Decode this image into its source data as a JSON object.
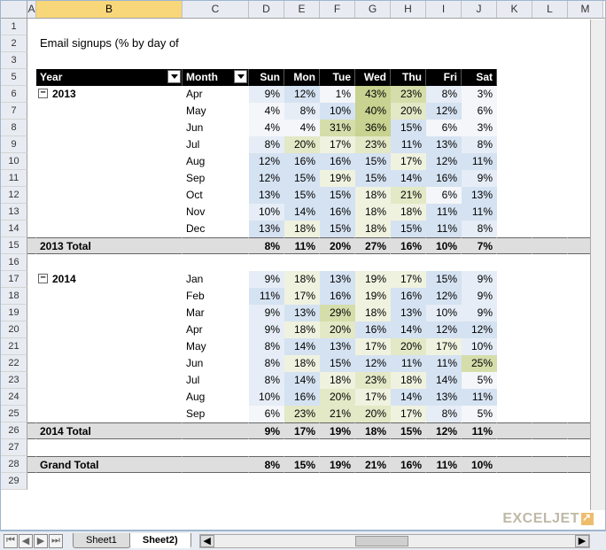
{
  "columns": [
    "A",
    "B",
    "C",
    "D",
    "E",
    "F",
    "G",
    "H",
    "I",
    "J",
    "K",
    "L",
    "M"
  ],
  "selected_column": "B",
  "row_numbers": [
    1,
    2,
    3,
    "",
    5,
    6,
    7,
    8,
    9,
    10,
    11,
    12,
    13,
    14,
    15,
    16,
    17,
    18,
    19,
    20,
    21,
    22,
    23,
    24,
    25,
    26,
    27,
    28,
    29
  ],
  "title": "Email signups (% by day of week)",
  "pivot_headers": {
    "year": "Year",
    "month": "Month",
    "days": [
      "Sun",
      "Mon",
      "Tue",
      "Wed",
      "Thu",
      "Fri",
      "Sat"
    ]
  },
  "sections": [
    {
      "year": "2013",
      "rows": [
        {
          "month": "Apr",
          "v": [
            "9%",
            "12%",
            "1%",
            "43%",
            "23%",
            "8%",
            "3%"
          ],
          "cls": [
            "h1",
            "h2",
            "h0",
            "g3",
            "g2",
            "h1",
            "h0"
          ]
        },
        {
          "month": "May",
          "v": [
            "4%",
            "8%",
            "10%",
            "40%",
            "20%",
            "12%",
            "6%"
          ],
          "cls": [
            "h0",
            "h1",
            "h2",
            "g3",
            "g1",
            "h2",
            "h0"
          ]
        },
        {
          "month": "Jun",
          "v": [
            "4%",
            "4%",
            "31%",
            "36%",
            "15%",
            "6%",
            "3%"
          ],
          "cls": [
            "h0",
            "h0",
            "g2",
            "g3",
            "h2",
            "h0",
            "h0"
          ]
        },
        {
          "month": "Jul",
          "v": [
            "8%",
            "20%",
            "17%",
            "23%",
            "11%",
            "13%",
            "8%"
          ],
          "cls": [
            "h1",
            "g1",
            "g0",
            "g1",
            "h2",
            "h2",
            "h1"
          ]
        },
        {
          "month": "Aug",
          "v": [
            "12%",
            "16%",
            "16%",
            "15%",
            "17%",
            "12%",
            "11%"
          ],
          "cls": [
            "h2",
            "h2",
            "h2",
            "h2",
            "g0",
            "h2",
            "h2"
          ]
        },
        {
          "month": "Sep",
          "v": [
            "12%",
            "15%",
            "19%",
            "15%",
            "14%",
            "16%",
            "9%"
          ],
          "cls": [
            "h2",
            "h2",
            "g0",
            "h2",
            "h2",
            "h2",
            "h1"
          ]
        },
        {
          "month": "Oct",
          "v": [
            "13%",
            "15%",
            "15%",
            "18%",
            "21%",
            "6%",
            "13%"
          ],
          "cls": [
            "h2",
            "h2",
            "h2",
            "g0",
            "g1",
            "h0",
            "h2"
          ]
        },
        {
          "month": "Nov",
          "v": [
            "10%",
            "14%",
            "16%",
            "18%",
            "18%",
            "11%",
            "11%"
          ],
          "cls": [
            "h1",
            "h2",
            "h2",
            "g0",
            "g0",
            "h2",
            "h2"
          ]
        },
        {
          "month": "Dec",
          "v": [
            "13%",
            "18%",
            "15%",
            "18%",
            "15%",
            "11%",
            "8%"
          ],
          "cls": [
            "h2",
            "g0",
            "h2",
            "g0",
            "h2",
            "h2",
            "h1"
          ]
        }
      ],
      "total_label": "2013 Total",
      "total": [
        "8%",
        "11%",
        "20%",
        "27%",
        "16%",
        "10%",
        "7%"
      ]
    },
    {
      "year": "2014",
      "rows": [
        {
          "month": "Jan",
          "v": [
            "9%",
            "18%",
            "13%",
            "19%",
            "17%",
            "15%",
            "9%"
          ],
          "cls": [
            "h1",
            "g0",
            "h2",
            "g0",
            "g0",
            "h2",
            "h1"
          ]
        },
        {
          "month": "Feb",
          "v": [
            "11%",
            "17%",
            "16%",
            "19%",
            "16%",
            "12%",
            "9%"
          ],
          "cls": [
            "h2",
            "g0",
            "h2",
            "g0",
            "h2",
            "h2",
            "h1"
          ]
        },
        {
          "month": "Mar",
          "v": [
            "9%",
            "13%",
            "29%",
            "18%",
            "13%",
            "10%",
            "9%"
          ],
          "cls": [
            "h1",
            "h2",
            "g2",
            "g0",
            "h2",
            "h1",
            "h1"
          ]
        },
        {
          "month": "Apr",
          "v": [
            "9%",
            "18%",
            "20%",
            "16%",
            "14%",
            "12%",
            "12%"
          ],
          "cls": [
            "h1",
            "g0",
            "g1",
            "h2",
            "h2",
            "h2",
            "h2"
          ]
        },
        {
          "month": "May",
          "v": [
            "8%",
            "14%",
            "13%",
            "17%",
            "20%",
            "17%",
            "10%"
          ],
          "cls": [
            "h1",
            "h2",
            "h2",
            "g0",
            "g1",
            "g0",
            "h1"
          ]
        },
        {
          "month": "Jun",
          "v": [
            "8%",
            "18%",
            "15%",
            "12%",
            "11%",
            "11%",
            "25%"
          ],
          "cls": [
            "h1",
            "g0",
            "h2",
            "h2",
            "h2",
            "h2",
            "g2"
          ]
        },
        {
          "month": "Jul",
          "v": [
            "8%",
            "14%",
            "18%",
            "23%",
            "18%",
            "14%",
            "5%"
          ],
          "cls": [
            "h1",
            "h2",
            "g0",
            "g1",
            "g0",
            "h2",
            "h0"
          ]
        },
        {
          "month": "Aug",
          "v": [
            "10%",
            "16%",
            "20%",
            "17%",
            "14%",
            "13%",
            "11%"
          ],
          "cls": [
            "h1",
            "h2",
            "g1",
            "g0",
            "h2",
            "h2",
            "h2"
          ]
        },
        {
          "month": "Sep",
          "v": [
            "6%",
            "23%",
            "21%",
            "20%",
            "17%",
            "8%",
            "5%"
          ],
          "cls": [
            "h0",
            "g1",
            "g1",
            "g1",
            "g0",
            "h1",
            "h0"
          ]
        }
      ],
      "total_label": "2014 Total",
      "total": [
        "9%",
        "17%",
        "19%",
        "18%",
        "15%",
        "12%",
        "11%"
      ]
    }
  ],
  "grand_total_label": "Grand Total",
  "grand_total": [
    "8%",
    "15%",
    "19%",
    "21%",
    "16%",
    "11%",
    "10%"
  ],
  "tabs": [
    "Sheet1",
    "Sheet2)"
  ],
  "active_tab": 1,
  "watermark": "EXCELJET",
  "chart_data": {
    "type": "table",
    "title": "Email signups (% by day of week)",
    "columns": [
      "Sun",
      "Mon",
      "Tue",
      "Wed",
      "Thu",
      "Fri",
      "Sat"
    ],
    "rows": [
      {
        "year": 2013,
        "month": "Apr",
        "values": [
          9,
          12,
          1,
          43,
          23,
          8,
          3
        ]
      },
      {
        "year": 2013,
        "month": "May",
        "values": [
          4,
          8,
          10,
          40,
          20,
          12,
          6
        ]
      },
      {
        "year": 2013,
        "month": "Jun",
        "values": [
          4,
          4,
          31,
          36,
          15,
          6,
          3
        ]
      },
      {
        "year": 2013,
        "month": "Jul",
        "values": [
          8,
          20,
          17,
          23,
          11,
          13,
          8
        ]
      },
      {
        "year": 2013,
        "month": "Aug",
        "values": [
          12,
          16,
          16,
          15,
          17,
          12,
          11
        ]
      },
      {
        "year": 2013,
        "month": "Sep",
        "values": [
          12,
          15,
          19,
          15,
          14,
          16,
          9
        ]
      },
      {
        "year": 2013,
        "month": "Oct",
        "values": [
          13,
          15,
          15,
          18,
          21,
          6,
          13
        ]
      },
      {
        "year": 2013,
        "month": "Nov",
        "values": [
          10,
          14,
          16,
          18,
          18,
          11,
          11
        ]
      },
      {
        "year": 2013,
        "month": "Dec",
        "values": [
          13,
          18,
          15,
          18,
          15,
          11,
          8
        ]
      },
      {
        "year": 2014,
        "month": "Jan",
        "values": [
          9,
          18,
          13,
          19,
          17,
          15,
          9
        ]
      },
      {
        "year": 2014,
        "month": "Feb",
        "values": [
          11,
          17,
          16,
          19,
          16,
          12,
          9
        ]
      },
      {
        "year": 2014,
        "month": "Mar",
        "values": [
          9,
          13,
          29,
          18,
          13,
          10,
          9
        ]
      },
      {
        "year": 2014,
        "month": "Apr",
        "values": [
          9,
          18,
          20,
          16,
          14,
          12,
          12
        ]
      },
      {
        "year": 2014,
        "month": "May",
        "values": [
          8,
          14,
          13,
          17,
          20,
          17,
          10
        ]
      },
      {
        "year": 2014,
        "month": "Jun",
        "values": [
          8,
          18,
          15,
          12,
          11,
          11,
          25
        ]
      },
      {
        "year": 2014,
        "month": "Jul",
        "values": [
          8,
          14,
          18,
          23,
          18,
          14,
          5
        ]
      },
      {
        "year": 2014,
        "month": "Aug",
        "values": [
          10,
          16,
          20,
          17,
          14,
          13,
          11
        ]
      },
      {
        "year": 2014,
        "month": "Sep",
        "values": [
          6,
          23,
          21,
          20,
          17,
          8,
          5
        ]
      }
    ],
    "totals": {
      "2013": [
        8,
        11,
        20,
        27,
        16,
        10,
        7
      ],
      "2014": [
        9,
        17,
        19,
        18,
        15,
        12,
        11
      ],
      "Grand": [
        8,
        15,
        19,
        21,
        16,
        11,
        10
      ]
    }
  }
}
